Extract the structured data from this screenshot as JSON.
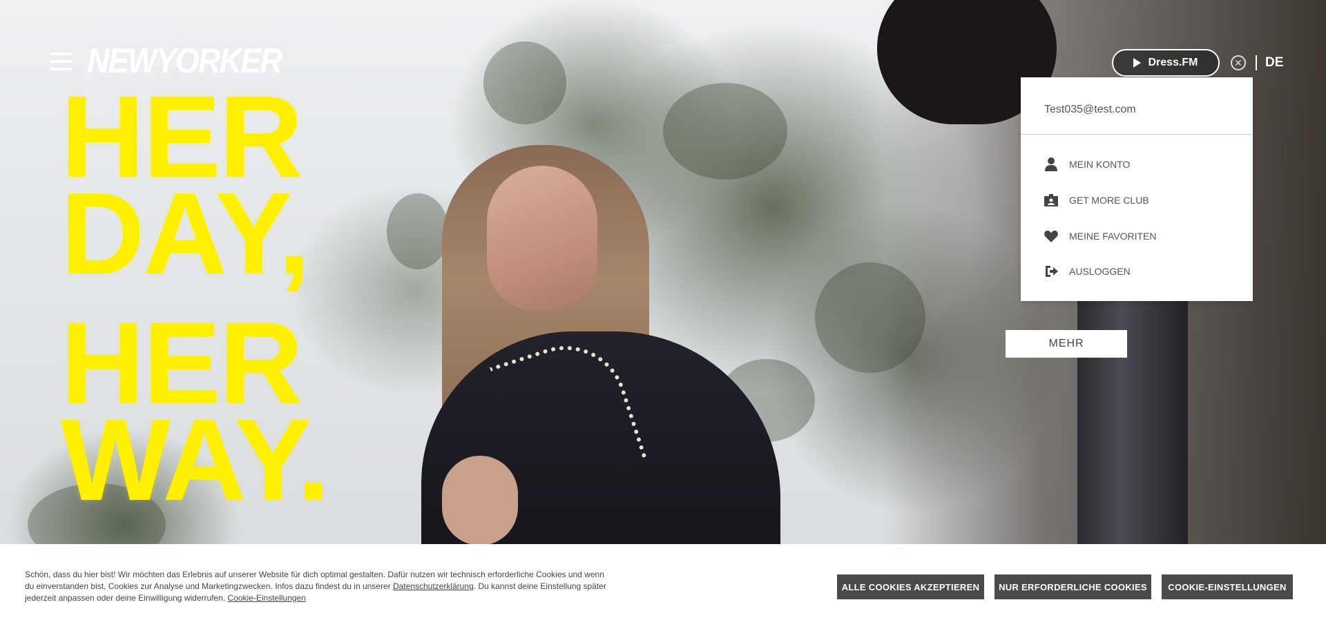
{
  "header": {
    "logo_text": "NEWYORKER",
    "dressfm_label": "Dress.FM",
    "language": "DE"
  },
  "hero": {
    "headline_lines": [
      "HER",
      "DAY,",
      "HER",
      "WAY."
    ],
    "more_button": "MEHR"
  },
  "account_menu": {
    "email": "Test035@test.com",
    "items": [
      {
        "label": "MEIN KONTO",
        "icon": "person-icon"
      },
      {
        "label": "GET MORE CLUB",
        "icon": "club-card-icon"
      },
      {
        "label": "MEINE FAVORITEN",
        "icon": "heart-icon"
      },
      {
        "label": "AUSLOGGEN",
        "icon": "logout-icon"
      }
    ]
  },
  "cookie_banner": {
    "text_part1": "Schön, dass du hier bist! Wir möchten das Erlebnis auf unserer Website für dich optimal gestalten. Dafür nutzen wir technisch erforderliche Cookies und wenn du einverstanden bist, Cookies zur Analyse und Marketingzwecken. Infos dazu findest du in unserer ",
    "privacy_link": "Datenschutzerklärung",
    "text_part2": ". Du kannst deine Einstellung später jederzeit anpassen oder deine Einwilligung widerrufen. ",
    "settings_link": "Cookie-Einstellungen",
    "buttons": {
      "accept_all": "ALLE COOKIES AKZEPTIEREN",
      "required_only": "NUR ERFORDERLICHE COOKIES",
      "settings": "COOKIE-EINSTELLUNGEN"
    }
  },
  "colors": {
    "headline_yellow": "#ffef00",
    "button_gray": "#4a4a4a",
    "text_gray": "#555555"
  }
}
